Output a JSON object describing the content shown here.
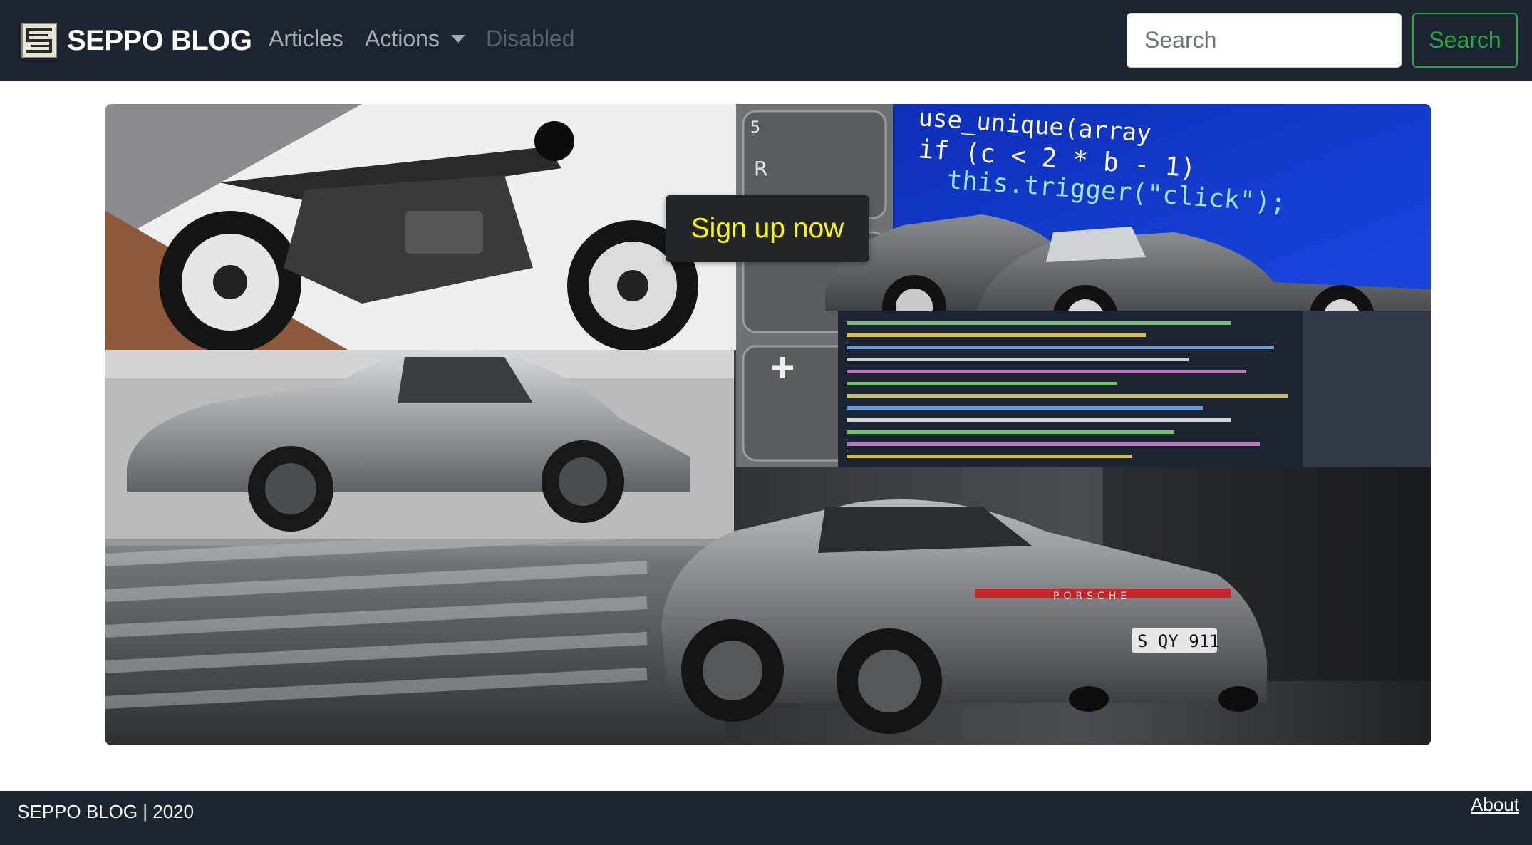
{
  "nav": {
    "brand": "SEPPO BLOG",
    "links": [
      {
        "label": "Articles"
      },
      {
        "label": "Actions"
      },
      {
        "label": "Disabled"
      }
    ],
    "search": {
      "placeholder": "Search",
      "button_label": "Search"
    }
  },
  "hero": {
    "cta_label": "Sign up now",
    "code_line_1": "use_unique(array",
    "code_line_2": "if (c < 2 * b - 1)",
    "code_line_3": "this.trigger(\"click\");",
    "key_label_r": "R",
    "key_label_5": "5",
    "plate": "S QY 911",
    "rear_badge": "PORSCHE"
  },
  "footer": {
    "text": "SEPPO BLOG | 2020",
    "about_label": "About"
  },
  "colors": {
    "navbar_bg": "#1b2430",
    "success": "#28a745",
    "cta_text": "#fff700"
  }
}
